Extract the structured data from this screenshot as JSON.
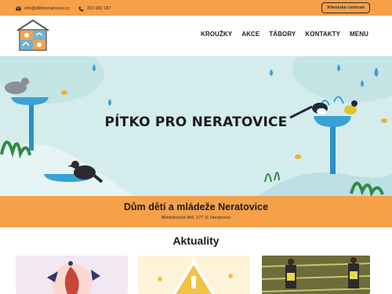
{
  "topbar": {
    "email": "info@ddmneratovice.cz",
    "phone": "315 682 187",
    "client_button": "Klientské centrum"
  },
  "nav": {
    "items": [
      "KROUŽKY",
      "AKCE",
      "TÁBORY",
      "KONTAKTY",
      "MENU"
    ]
  },
  "hero": {
    "title": "PÍTKO PRO NERATOVICE"
  },
  "organization": {
    "name": "Dům dětí a mládeže Neratovice",
    "address": "Mládežnická 984, 277 11 Neratovice"
  },
  "news": {
    "heading": "Aktuality"
  },
  "colors": {
    "accent_orange": "#f6a04a",
    "hero_bg": "#d4ecec",
    "water_blue": "#3aa0d8"
  }
}
